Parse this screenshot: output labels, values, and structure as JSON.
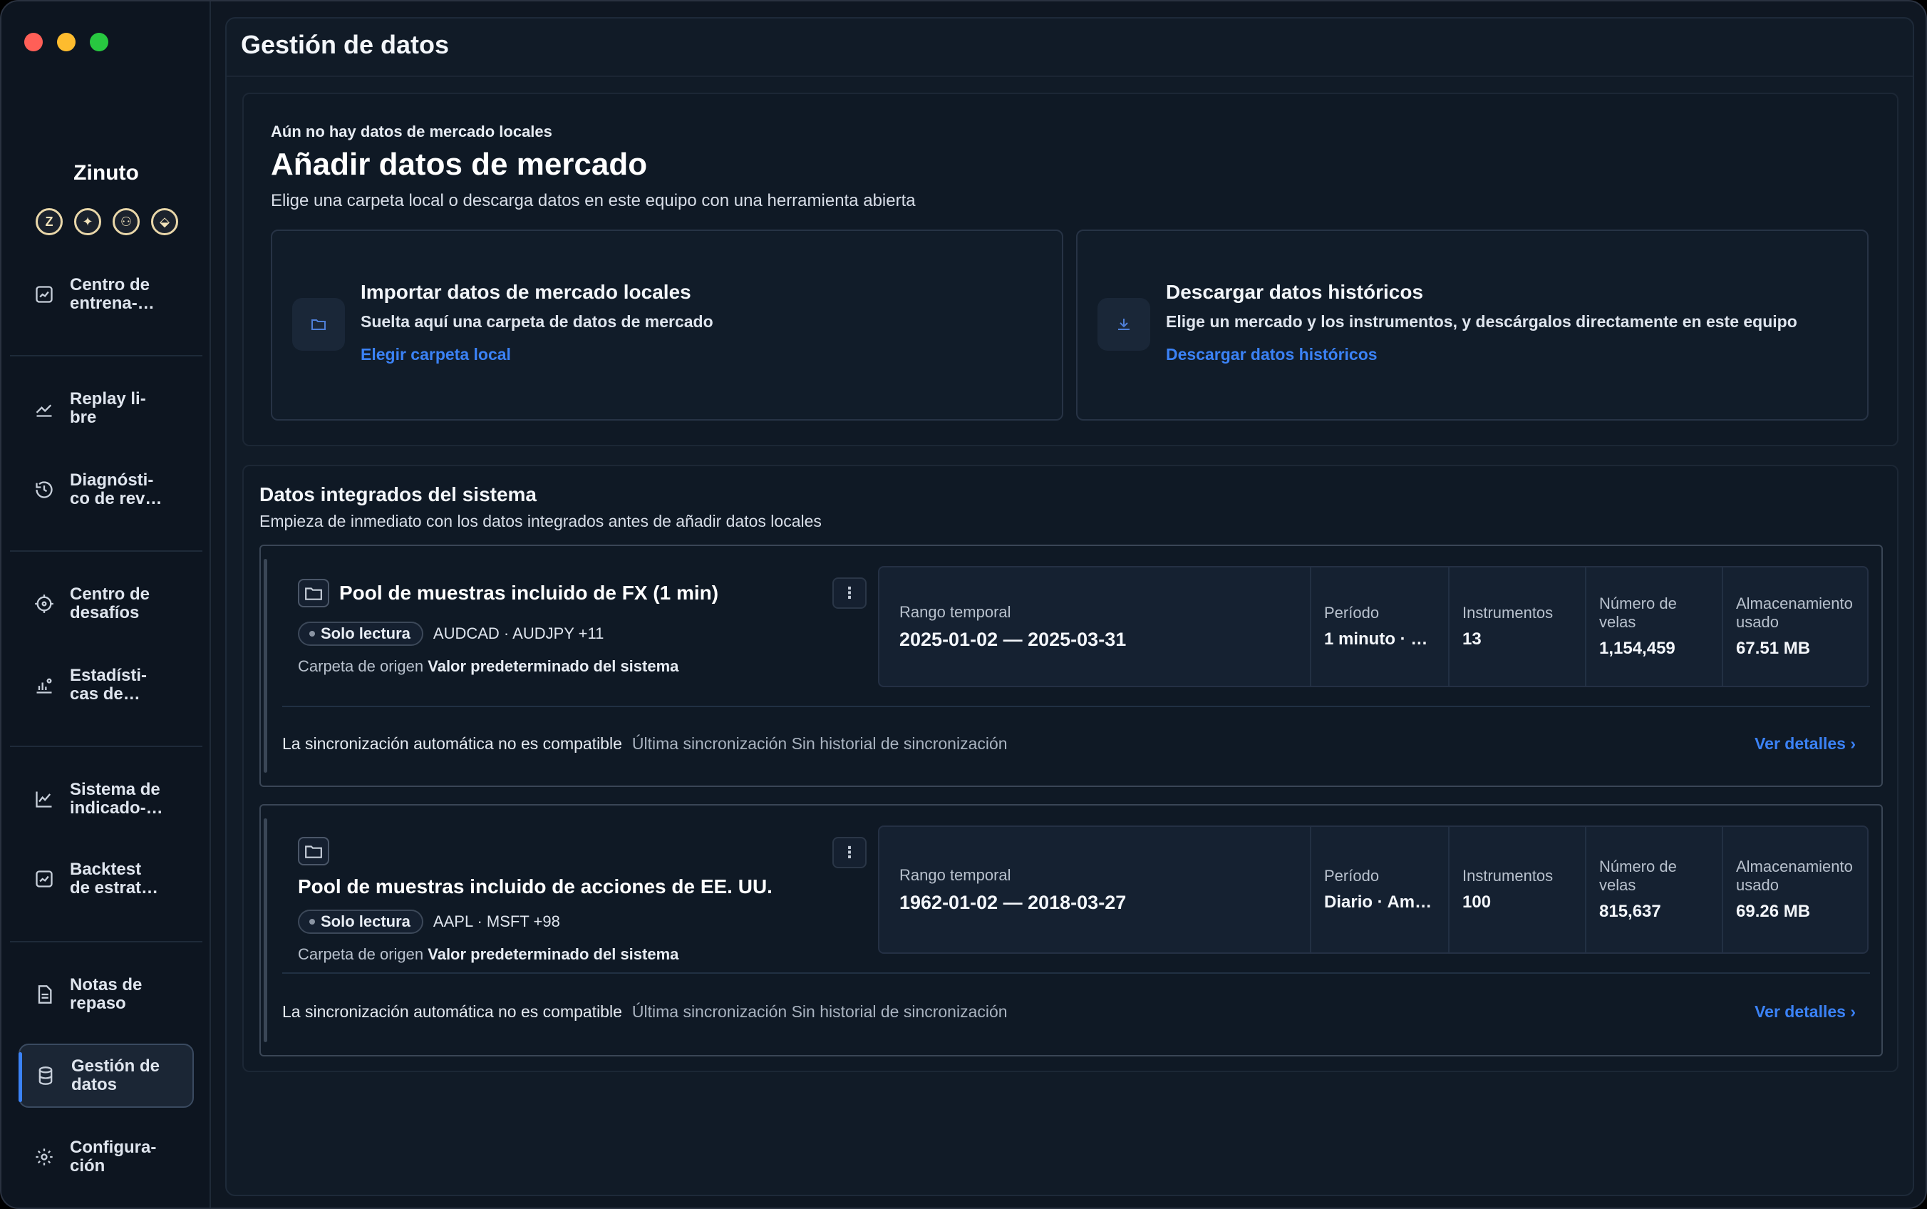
{
  "app": {
    "name": "Zinuto",
    "brand_icons": [
      "Z",
      "✦",
      "⚇",
      "⬙"
    ]
  },
  "sidebar": {
    "items": [
      {
        "label": "Centro de\nentrena-…",
        "icon": "chart-box-icon"
      },
      {
        "label": "Replay li-\nbre",
        "icon": "trend-up-icon"
      },
      {
        "label": "Diagnósti-\nco de rev…",
        "icon": "history-icon"
      },
      {
        "label": "Centro de\ndesafíos",
        "icon": "target-icon"
      },
      {
        "label": "Estadísti-\ncas de…",
        "icon": "bar-person-icon"
      },
      {
        "label": "Sistema de\nindicado-…",
        "icon": "line-chart-icon"
      },
      {
        "label": "Backtest\nde estrat…",
        "icon": "chart-box-icon"
      },
      {
        "label": "Notas de\nrepaso",
        "icon": "document-icon"
      },
      {
        "label": "Gestión de\ndatos",
        "icon": "database-icon",
        "active": true
      },
      {
        "label": "Configura-\nción",
        "icon": "gear-icon"
      }
    ]
  },
  "page": {
    "title": "Gestión de datos"
  },
  "add_market": {
    "eyebrow": "Aún no hay datos de mercado locales",
    "title": "Añadir datos de mercado",
    "subtitle": "Elige una carpeta local o descarga datos en este equipo con una herramienta abierta",
    "import_card": {
      "title": "Importar datos de mercado locales",
      "description": "Suelta aquí una carpeta de datos de mercado",
      "link": "Elegir carpeta local"
    },
    "download_card": {
      "title": "Descargar datos históricos",
      "description": "Elige un mercado y los instrumentos, y descárgalos directamente en este equipo",
      "link": "Descargar datos históricos"
    }
  },
  "builtin": {
    "title": "Datos integrados del sistema",
    "subtitle": "Empieza de inmediato con los datos integrados antes de añadir datos locales",
    "stat_labels": {
      "range": "Rango temporal",
      "period": "Período",
      "instruments": "Instrumentos",
      "candles": "Número de\nvelas",
      "storage": "Almacenamiento\nusado"
    },
    "origin_label": "Carpeta de origen",
    "sync_label": "La sincronización automática no es compatible",
    "last_sync": "Última sincronización Sin historial de sincronización",
    "details_link": "Ver detalles ›",
    "readonly_badge": "Solo lectura",
    "menu_glyph": "⋮",
    "pools": [
      {
        "title": "Pool de muestras incluido de FX (1 min)",
        "tickers": "AUDCAD · AUDJPY +11",
        "origin": "Valor predeterminado del sistema",
        "range": "2025-01-02 — 2025-03-31",
        "period": "1 minuto · …",
        "instruments": "13",
        "candles": "1,154,459",
        "storage": "67.51 MB"
      },
      {
        "title": "Pool de muestras incluido de acciones de EE. UU.",
        "tickers": "AAPL · MSFT +98",
        "origin": "Valor predeterminado del sistema",
        "range": "1962-01-02 — 2018-03-27",
        "period": "Diario · Am…",
        "instruments": "100",
        "candles": "815,637",
        "storage": "69.26 MB"
      }
    ]
  }
}
